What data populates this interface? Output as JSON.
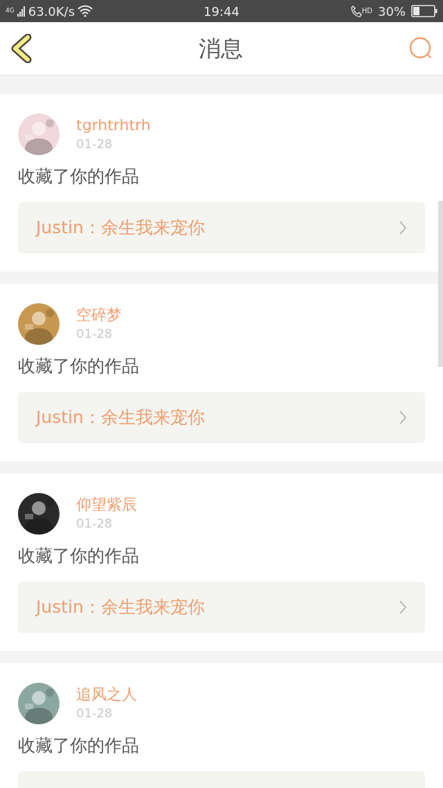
{
  "status_bar": {
    "network": "4G",
    "speed": "63.0K/s",
    "time": "19:44",
    "hd": "HD",
    "battery_text": "30%"
  },
  "header": {
    "title": "消息"
  },
  "messages": [
    {
      "user": "tgrhtrhtrh",
      "date": "01-28",
      "action": "收藏了你的作品",
      "work": "Justin：余生我来宠你"
    },
    {
      "user": "空碎梦",
      "date": "01-28",
      "action": "收藏了你的作品",
      "work": "Justin：余生我来宠你"
    },
    {
      "user": "仰望紫辰",
      "date": "01-28",
      "action": "收藏了你的作品",
      "work": "Justin：余生我来宠你"
    },
    {
      "user": "追风之人",
      "date": "01-28",
      "action": "收藏了你的作品"
    }
  ]
}
